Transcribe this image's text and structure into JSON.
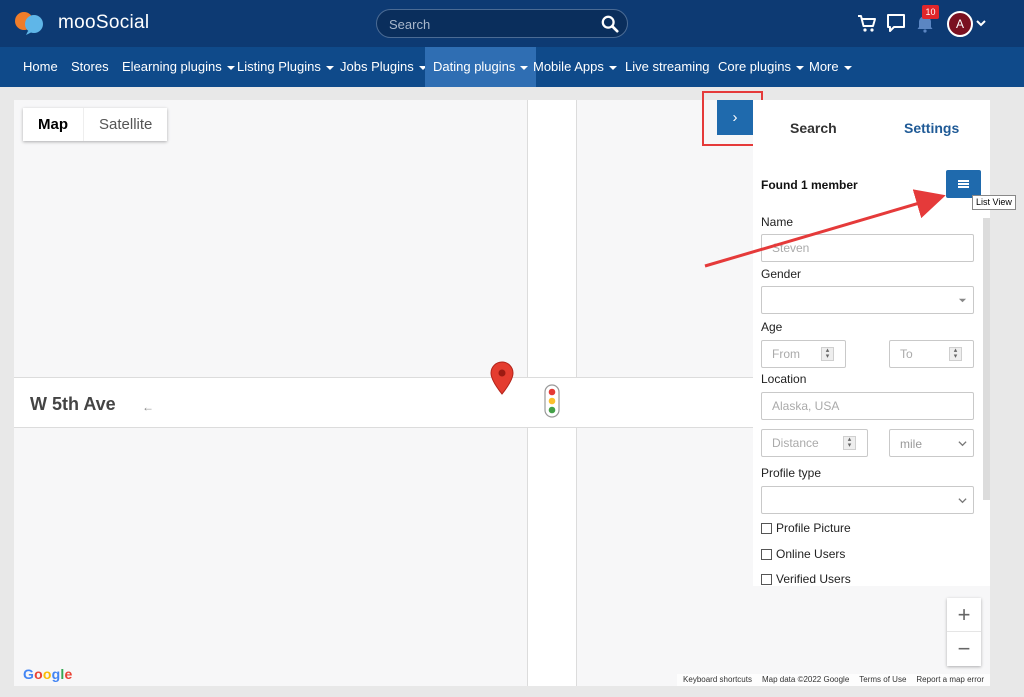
{
  "header": {
    "brand": "mooSocial",
    "search_placeholder": "Search",
    "notification_count": "10",
    "avatar_initial": "A"
  },
  "nav": {
    "items": [
      {
        "label": "Home",
        "dropdown": false
      },
      {
        "label": "Stores",
        "dropdown": false
      },
      {
        "label": "Elearning plugins",
        "dropdown": true
      },
      {
        "label": "Listing Plugins",
        "dropdown": true
      },
      {
        "label": "Jobs Plugins",
        "dropdown": true
      },
      {
        "label": "Dating plugins",
        "dropdown": true,
        "active": true
      },
      {
        "label": "Mobile Apps",
        "dropdown": true
      },
      {
        "label": "Live streaming",
        "dropdown": false
      },
      {
        "label": "Core plugins",
        "dropdown": true
      },
      {
        "label": "More",
        "dropdown": true
      }
    ]
  },
  "map": {
    "type_tabs": [
      "Map",
      "Satellite"
    ],
    "street_name": "W 5th Ave",
    "google_letters": [
      "G",
      "o",
      "o",
      "g",
      "l",
      "e"
    ],
    "attribution": [
      "Keyboard shortcuts",
      "Map data ©2022 Google",
      "Terms of Use",
      "Report a map error"
    ],
    "zoom_in": "+",
    "zoom_out": "−"
  },
  "panel": {
    "toggle_icon": "›",
    "tabs": {
      "search": "Search",
      "settings": "Settings"
    },
    "found_text": "Found 1 member",
    "list_view_tooltip": "List View",
    "name_label": "Name",
    "name_placeholder": "Steven",
    "gender_label": "Gender",
    "age_label": "Age",
    "age_from_placeholder": "From",
    "age_to_placeholder": "To",
    "location_label": "Location",
    "location_placeholder": "Alaska, USA",
    "distance_placeholder": "Distance",
    "distance_unit": "mile",
    "profile_type_label": "Profile type",
    "checkboxes": [
      "Profile Picture",
      "Online Users",
      "Verified Users"
    ]
  },
  "colors": {
    "header_bg": "#0d3a73",
    "nav_bg": "#0f4a8a",
    "nav_active": "#2f6eb3",
    "button_blue": "#1f6aad",
    "annotation_red": "#e53a3a",
    "badge_red": "#e0262a",
    "google_colors": [
      "#4285F4",
      "#EA4335",
      "#FBBC05",
      "#4285F4",
      "#34A853",
      "#EA4335"
    ]
  }
}
